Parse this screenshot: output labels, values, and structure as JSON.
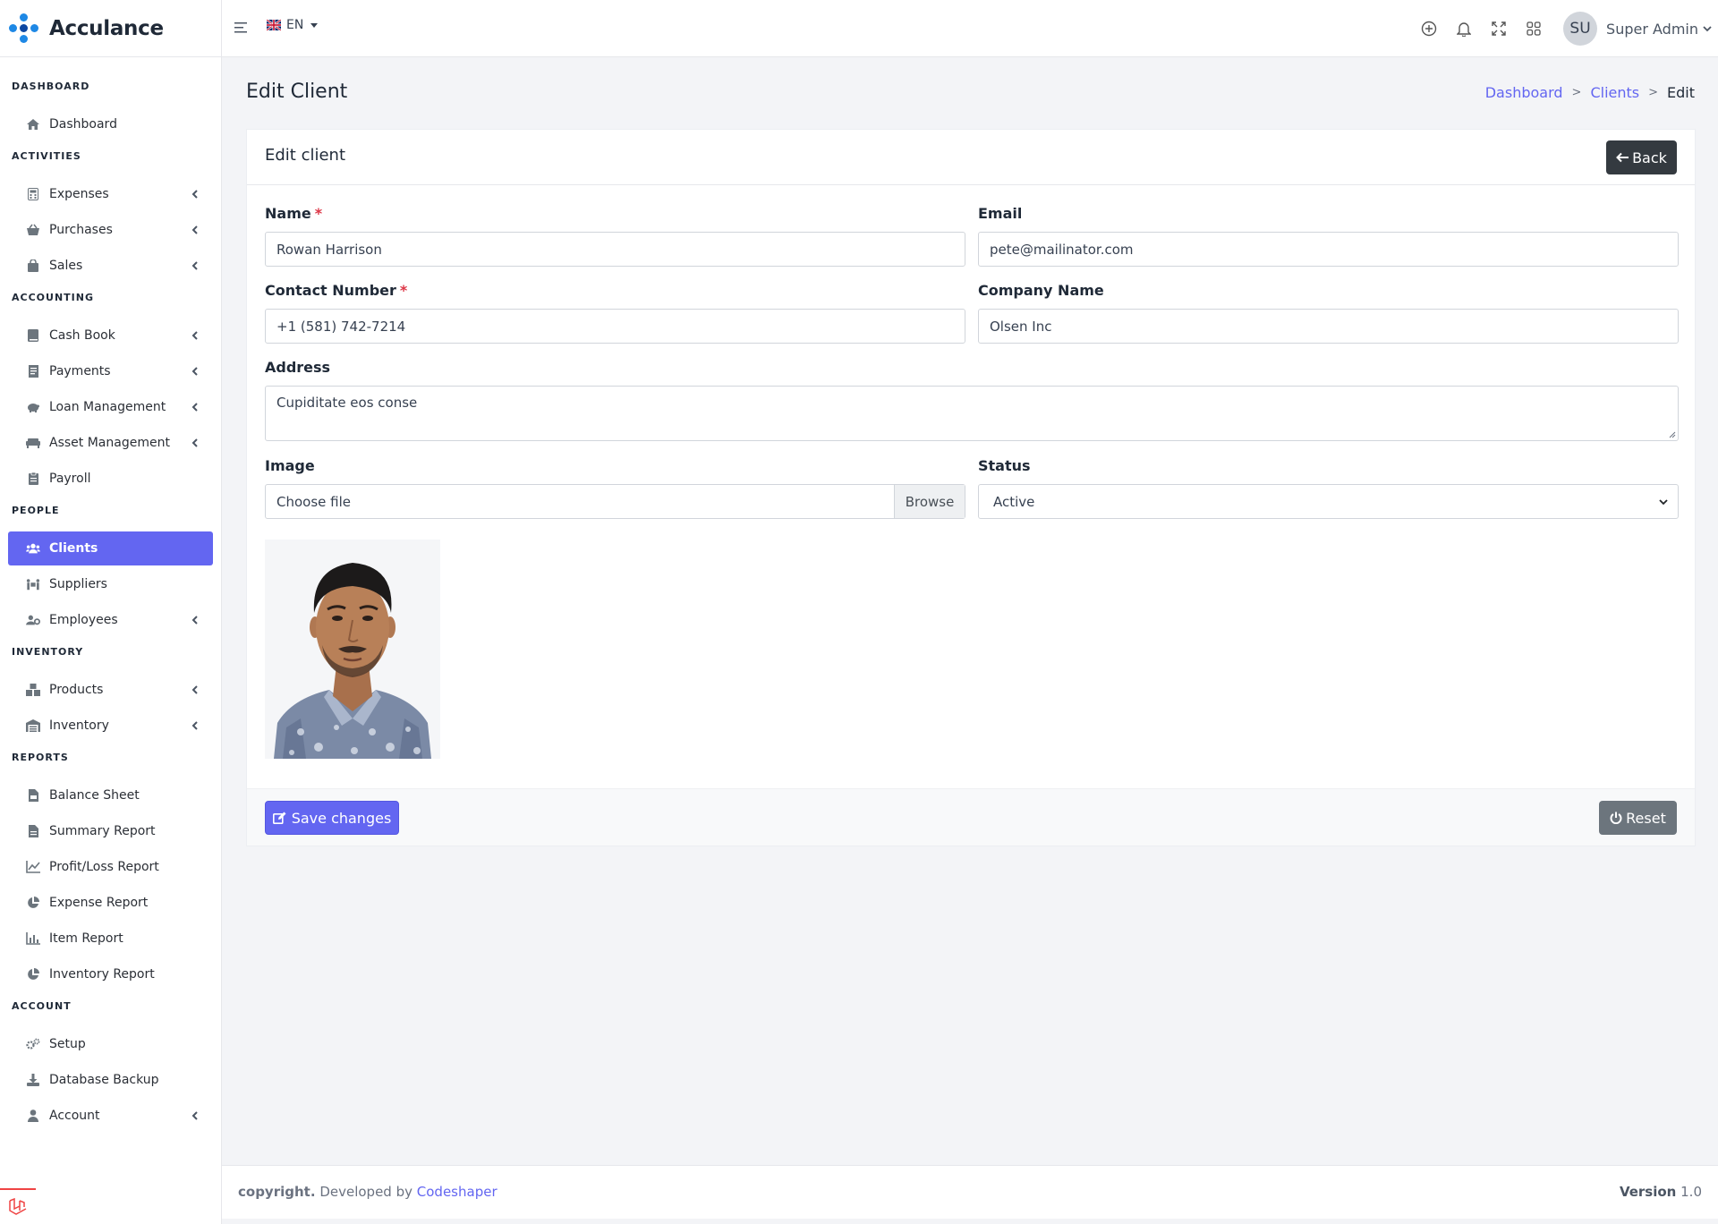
{
  "brand": {
    "name": "Acculance"
  },
  "colors": {
    "accent": "#6366f1",
    "dark_button": "#343a40",
    "reset_button": "#6c757d",
    "required": "#dc3545"
  },
  "header": {
    "language": "EN",
    "icons": [
      "plus-circle-icon",
      "bell-icon",
      "fullscreen-icon",
      "apps-grid-icon"
    ],
    "user": {
      "initials": "SU",
      "name": "Super Admin"
    }
  },
  "sidebar": {
    "sections": [
      {
        "title": "DASHBOARD",
        "items": [
          {
            "label": "Dashboard",
            "icon": "home-icon",
            "has_children": false
          }
        ]
      },
      {
        "title": "ACTIVITIES",
        "items": [
          {
            "label": "Expenses",
            "icon": "calculator-icon",
            "has_children": true
          },
          {
            "label": "Purchases",
            "icon": "basket-icon",
            "has_children": true
          },
          {
            "label": "Sales",
            "icon": "shopping-bag-icon",
            "has_children": true
          }
        ]
      },
      {
        "title": "ACCOUNTING",
        "items": [
          {
            "label": "Cash Book",
            "icon": "book-icon",
            "has_children": true
          },
          {
            "label": "Payments",
            "icon": "receipt-icon",
            "has_children": true
          },
          {
            "label": "Loan Management",
            "icon": "piggy-bank-icon",
            "has_children": true
          },
          {
            "label": "Asset Management",
            "icon": "couch-icon",
            "has_children": true
          },
          {
            "label": "Payroll",
            "icon": "clipboard-icon",
            "has_children": false
          }
        ]
      },
      {
        "title": "PEOPLE",
        "items": [
          {
            "label": "Clients",
            "icon": "users-icon",
            "has_children": false,
            "active": true
          },
          {
            "label": "Suppliers",
            "icon": "people-carry-icon",
            "has_children": false
          },
          {
            "label": "Employees",
            "icon": "users-cog-icon",
            "has_children": true
          }
        ]
      },
      {
        "title": "INVENTORY",
        "items": [
          {
            "label": "Products",
            "icon": "boxes-icon",
            "has_children": true
          },
          {
            "label": "Inventory",
            "icon": "warehouse-icon",
            "has_children": true
          }
        ]
      },
      {
        "title": "REPORTS",
        "items": [
          {
            "label": "Balance Sheet",
            "icon": "file-invoice-icon",
            "has_children": false
          },
          {
            "label": "Summary Report",
            "icon": "file-alt-icon",
            "has_children": false
          },
          {
            "label": "Profit/Loss Report",
            "icon": "chart-line-icon",
            "has_children": false
          },
          {
            "label": "Expense Report",
            "icon": "chart-pie-icon",
            "has_children": false
          },
          {
            "label": "Item Report",
            "icon": "chart-bar-icon",
            "has_children": false
          },
          {
            "label": "Inventory Report",
            "icon": "chart-pie-icon",
            "has_children": false
          }
        ]
      },
      {
        "title": "ACCOUNT",
        "items": [
          {
            "label": "Setup",
            "icon": "cogs-icon",
            "has_children": false
          },
          {
            "label": "Database Backup",
            "icon": "download-icon",
            "has_children": false
          },
          {
            "label": "Account",
            "icon": "user-icon",
            "has_children": true
          }
        ]
      }
    ]
  },
  "page": {
    "title": "Edit Client",
    "breadcrumb": {
      "items": [
        "Dashboard",
        "Clients"
      ],
      "current": "Edit",
      "separator": ">"
    }
  },
  "form": {
    "card_title": "Edit client",
    "back_label": "Back",
    "name": {
      "label": "Name",
      "value": "Rowan Harrison",
      "required": "*"
    },
    "email": {
      "label": "Email",
      "value": "pete@mailinator.com"
    },
    "contact": {
      "label": "Contact Number",
      "value": "+1 (581) 742-7214",
      "required": "*"
    },
    "company": {
      "label": "Company Name",
      "value": "Olsen Inc"
    },
    "address": {
      "label": "Address",
      "value": "Cupiditate eos conse"
    },
    "image": {
      "label": "Image",
      "placeholder": "Choose file",
      "browse": "Browse"
    },
    "status": {
      "label": "Status",
      "value": "Active"
    },
    "save_label": "Save changes",
    "reset_label": "Reset"
  },
  "footer": {
    "copyright": "copyright.",
    "developed_by": "Developed by",
    "company": "Codeshaper",
    "version_label": "Version",
    "version": "1.0"
  }
}
